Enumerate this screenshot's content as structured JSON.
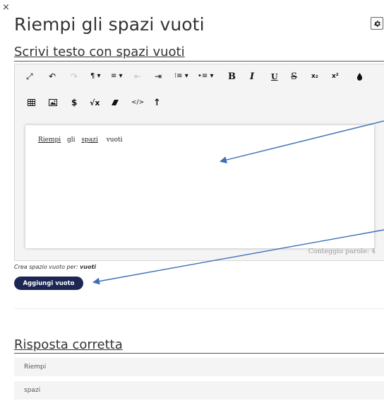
{
  "modal": {
    "close_glyph": "×",
    "title": "Riempi gli spazi vuoti",
    "settings_icon": "gear-icon"
  },
  "editor_section": {
    "title": "Scrivi testo con spazi vuoti"
  },
  "toolbar": {
    "row1": [
      {
        "name": "fullscreen-icon",
        "glyph": "⤢",
        "enabled": true
      },
      {
        "name": "undo-icon",
        "glyph": "↶",
        "enabled": true
      },
      {
        "name": "redo-icon",
        "glyph": "↷",
        "enabled": false
      },
      {
        "name": "paragraph-format-icon",
        "glyph": "¶ ▾",
        "enabled": true
      },
      {
        "name": "align-icon",
        "glyph": "≡ ▾",
        "enabled": true
      },
      {
        "name": "outdent-icon",
        "glyph": "⇤",
        "enabled": false
      },
      {
        "name": "indent-icon",
        "glyph": "⇥",
        "enabled": true
      },
      {
        "name": "ordered-list-icon",
        "glyph": "⁝≡ ▾",
        "enabled": true
      },
      {
        "name": "unordered-list-icon",
        "glyph": "•≡ ▾",
        "enabled": true
      },
      {
        "name": "bold-icon",
        "glyph": "B",
        "enabled": true
      },
      {
        "name": "italic-icon",
        "glyph": "I",
        "enabled": true
      },
      {
        "name": "underline-icon",
        "glyph": "U",
        "enabled": true
      },
      {
        "name": "strikethrough-icon",
        "glyph": "S",
        "enabled": true
      },
      {
        "name": "subscript-icon",
        "glyph": "x₂",
        "enabled": true
      },
      {
        "name": "superscript-icon",
        "glyph": "x²",
        "enabled": true
      },
      {
        "name": "text-color-icon",
        "glyph": "💧",
        "enabled": true
      }
    ],
    "row2": [
      {
        "name": "table-icon",
        "glyph": "▦",
        "enabled": true
      },
      {
        "name": "image-icon",
        "glyph": "🖼",
        "enabled": true
      },
      {
        "name": "dollar-icon",
        "glyph": "$",
        "enabled": true
      },
      {
        "name": "math-formula-icon",
        "glyph": "√x",
        "enabled": true
      },
      {
        "name": "clear-formatting-icon",
        "glyph": "⌫",
        "enabled": true
      },
      {
        "name": "code-view-icon",
        "glyph": "</>",
        "enabled": true
      },
      {
        "name": "arrow-up-icon",
        "glyph": "↑",
        "enabled": true
      }
    ]
  },
  "editor_content": {
    "blank1": "Riempi",
    "plain": "gli",
    "blank2": "spazi",
    "tail": "vuoti",
    "word_count": "Conteggio parole: 4"
  },
  "blank_hint": {
    "prefix": "Crea spazio vuoto per:",
    "word": "vuoti"
  },
  "add_blank_button": {
    "label": "Aggiungi vuoto"
  },
  "answer_section": {
    "title": "Risposta corretta",
    "answers": [
      "Riempi",
      "spazi"
    ]
  },
  "colors": {
    "button_bg": "#1c2754",
    "arrow": "#3b6fb6",
    "panel_bg": "#f4f4f4"
  }
}
